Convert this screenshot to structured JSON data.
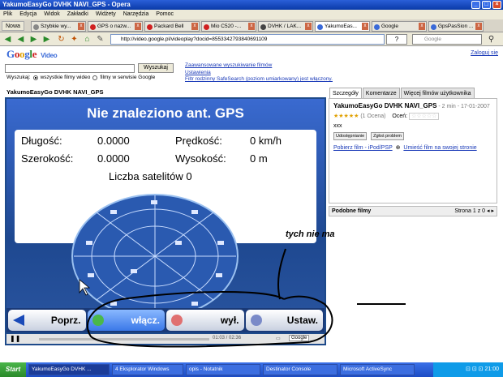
{
  "window": {
    "title": "YakumoEasyGo DVHK NAVI_GPS - Opera"
  },
  "menu": [
    "Plik",
    "Edycja",
    "Widok",
    "Zakładki",
    "Widżety",
    "Narzędzia",
    "Pomoc"
  ],
  "tabs": [
    {
      "label": "Nowa"
    },
    {
      "label": "Szybkie wy...",
      "color": "#888888"
    },
    {
      "label": "GPS o nazw...",
      "color": "#d02020"
    },
    {
      "label": "Packard Bell",
      "color": "#d02020"
    },
    {
      "label": "Mio C520 -...",
      "color": "#d02020"
    },
    {
      "label": "DVHK / LAK...",
      "color": "#444444"
    },
    {
      "label": "YakumoEas...",
      "color": "#3a6ad8"
    },
    {
      "label": "Google",
      "color": "#3a6ad8"
    },
    {
      "label": "GpsPasSion ...",
      "color": "#3a6ad8"
    }
  ],
  "address": {
    "url": "http://video.google.pl/videoplay?docid=8553342793840691109"
  },
  "search": {
    "placeholder": "Google"
  },
  "google": {
    "logo": "Google",
    "logo_sub": "Video",
    "login": "Zaloguj się",
    "search_button": "Wyszukaj",
    "adv_links": [
      "Zaawansowane wyszukiwanie filmów",
      "Ustawienia",
      "Filtr rodzinny SafeSearch (poziom umiarkowany) jest włączony."
    ],
    "search_label": "Wyszukaj:",
    "opt1": "wszystkie filmy wideo",
    "opt2": "filmy w serwisie Google"
  },
  "video": {
    "title": "YakumoEasyGo DVHK NAVI_GPS",
    "heading": "Nie znaleziono ant. GPS",
    "dlugosc_label": "Długość:",
    "dlugosc": "0.0000",
    "predkosc_label": "Prędkość:",
    "predkosc": "0 km/h",
    "szerokosc_label": "Szerokość:",
    "szerokosc": "0.0000",
    "wysokosc_label": "Wysokość:",
    "wysokosc": "0 m",
    "satelity": "Liczba satelitów 0",
    "buttons": [
      "Poprz.",
      "włącz.",
      "wył.",
      "Ustaw."
    ],
    "time": "01:03 / 02:36"
  },
  "details": {
    "tabs": [
      "Szczegóły",
      "Komentarze",
      "Więcej filmów użytkownika"
    ],
    "title": "YakumoEasyGo DVHK NAVI_GPS",
    "meta": "- 2 min - 17-01-2007",
    "rating": "(1 Ocena)",
    "rate_label": "Oceń:",
    "desc": "xxx",
    "share": "Udostępnianie",
    "report": "Zgłoś problem",
    "download": "Pobierz film - iPod/PSP",
    "embed": "Umieść film na swojej stronie",
    "related": "Podobne filmy",
    "page": "Strona 1 z 0"
  },
  "annotation": "tych nie ma",
  "taskbar": {
    "start": "Start",
    "items": [
      "YakumoEasyGo DVHK ...",
      "4 Eksplorator Windows",
      "opis - Notatnik",
      "Destinator Console",
      "Microsoft ActiveSync"
    ],
    "clock": "21:00"
  }
}
